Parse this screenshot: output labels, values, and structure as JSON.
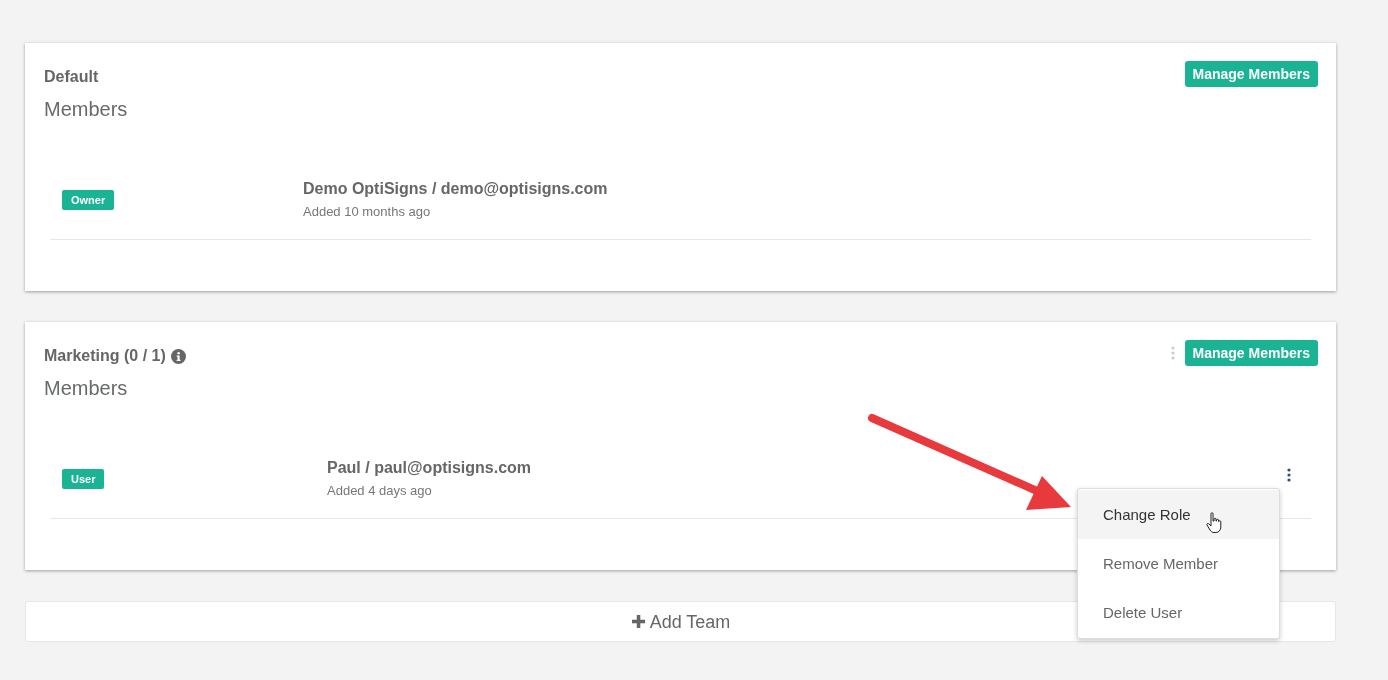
{
  "teams": [
    {
      "title": "Default",
      "info": false,
      "options_menu": false,
      "manage_button": "Manage Members",
      "section": "Members",
      "members": [
        {
          "role": "Owner",
          "name": "Demo OptiSigns / demo@optisigns.com",
          "added": "Added 10 months ago",
          "actions": false
        }
      ]
    },
    {
      "title": "Marketing (0 / 1)",
      "info": true,
      "options_menu": true,
      "manage_button": "Manage Members",
      "section": "Members",
      "members": [
        {
          "role": "User",
          "name": "Paul / paul@optisigns.com",
          "added": "Added 4 days ago",
          "actions": true
        }
      ]
    }
  ],
  "add_team": {
    "icon": "✚",
    "label": "Add Team"
  },
  "context_menu": {
    "items": [
      {
        "label": "Change Role",
        "selected": true
      },
      {
        "label": "Remove Member",
        "selected": false
      },
      {
        "label": "Delete User",
        "selected": false
      }
    ]
  }
}
